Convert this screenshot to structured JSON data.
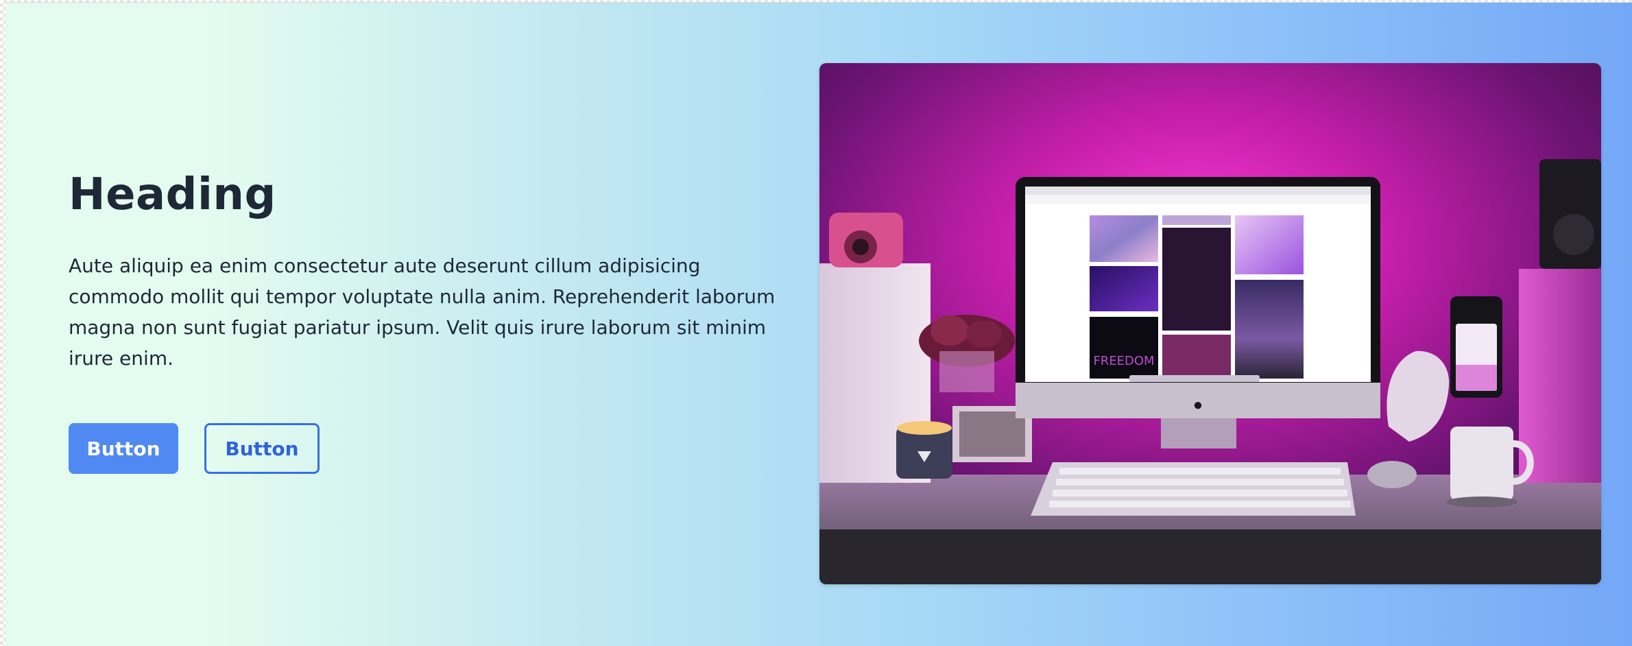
{
  "hero": {
    "heading": "Heading",
    "body": "Aute aliquip ea enim consectetur aute deserunt cillum adipisicing commodo mollit qui tempor voluptate nulla anim. Reprehenderit laborum magna non sunt fugiat pariatur ipsum. Velit quis irure laborum sit minim irure enim.",
    "primary_button_label": "Button",
    "secondary_button_label": "Button"
  },
  "image": {
    "screen_text": "FREEDOM"
  },
  "colors": {
    "gradient_start": "#e4fcef",
    "gradient_end": "#74a7f6",
    "primary_button": "#4f89f1",
    "secondary_button_border": "#3a6fe0",
    "heading_text": "#1e2836"
  }
}
